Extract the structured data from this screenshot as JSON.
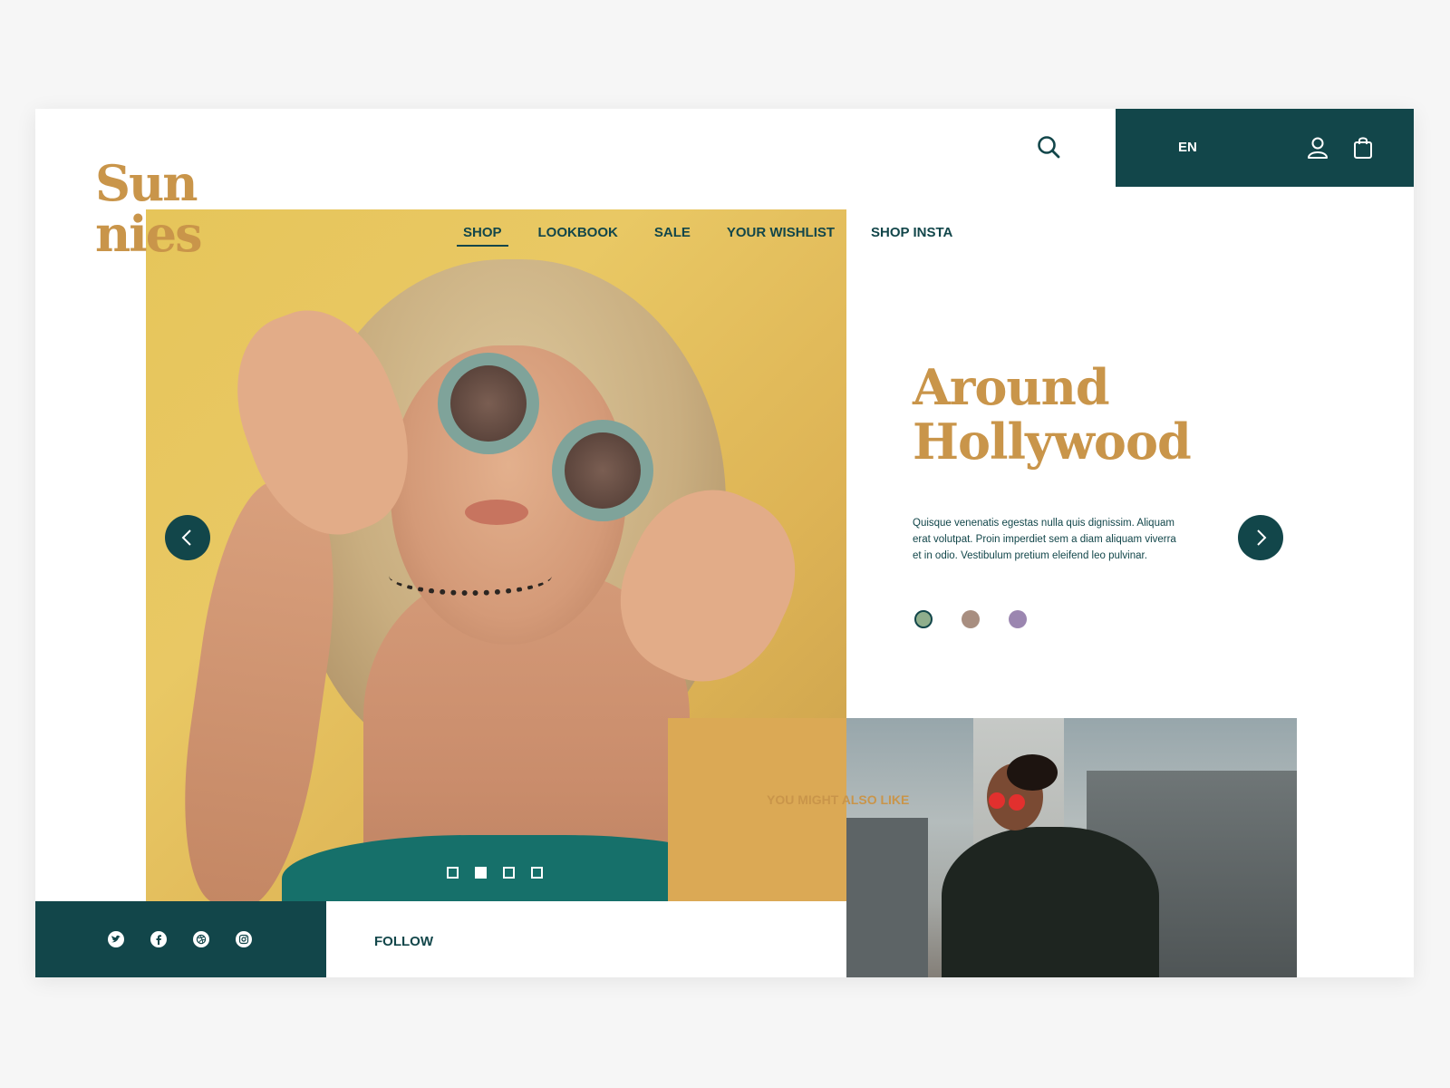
{
  "brand": {
    "line1": "Sun",
    "line2": "nies"
  },
  "header": {
    "language": "EN"
  },
  "nav": {
    "items": [
      {
        "label": "SHOP"
      },
      {
        "label": "LOOKBOOK"
      },
      {
        "label": "SALE"
      },
      {
        "label": "YOUR WISHLIST"
      },
      {
        "label": "SHOP INSTA"
      }
    ],
    "active": "SHOP"
  },
  "hero": {
    "title_line1": "Around",
    "title_line2": "Hollywood",
    "description": "Quisque venenatis egestas nulla quis dignissim. Aliquam erat volutpat. Proin imperdiet sem a diam aliquam viverra et in odio. Vestibulum pretium eleifend leo pulvinar.",
    "slide_count": 4,
    "active_slide": 2
  },
  "color_options": {
    "swatches": [
      "#8fae8c",
      "#a88e80",
      "#9b86b0"
    ],
    "selected": 1
  },
  "promo": {
    "label": "YOU MIGHT ALSO LIKE"
  },
  "footer": {
    "follow_label": "FOLLOW",
    "social": [
      "twitter-icon",
      "facebook-icon",
      "dribbble-icon",
      "instagram-icon"
    ]
  },
  "colors": {
    "accent": "#c9954a",
    "primary": "#12464a",
    "ochre": "#dba955"
  }
}
